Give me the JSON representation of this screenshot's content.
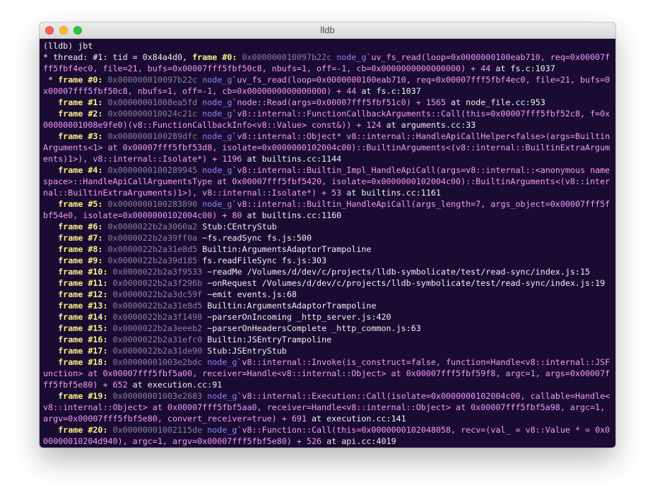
{
  "window": {
    "title": "lldb"
  },
  "terminal": {
    "lines": [
      [
        {
          "c": "txt",
          "t": "(lldb) jbt"
        }
      ],
      [
        {
          "c": "txt",
          "t": "* thread: #1: tid = 0x84a4d0, "
        },
        {
          "c": "fr",
          "t": "frame #0: "
        },
        {
          "c": "addr",
          "t": "0x000000010097b22c "
        },
        {
          "c": "mod",
          "t": "node_g"
        },
        {
          "c": "fn",
          "t": "`uv_fs_read(loop=0x0000000100eab710, req=0x00007fff5fbf4ec0, file=21, bufs=0x00007fff5fbf50c8, nbufs=1, off=-1, cb=0x0000000000000000) + 44 "
        },
        {
          "c": "txt",
          "t": "at fs.c:1037"
        }
      ],
      [
        {
          "c": "txt",
          "t": " * "
        },
        {
          "c": "fr",
          "t": "frame #0: "
        },
        {
          "c": "addr",
          "t": "0x000000010097b22c "
        },
        {
          "c": "mod",
          "t": "node_g"
        },
        {
          "c": "fn",
          "t": "`uv_fs_read(loop=0x0000000100eab710, req=0x00007fff5fbf4ec0, file=21, bufs=0x00007fff5fbf50c8, nbufs=1, off=-1, cb=0x0000000000000000) + 44 "
        },
        {
          "c": "txt",
          "t": "at fs.c:1037"
        }
      ],
      [
        {
          "c": "txt",
          "t": "   "
        },
        {
          "c": "fr",
          "t": "frame #1: "
        },
        {
          "c": "addr",
          "t": "0x00000001008ea5fd "
        },
        {
          "c": "mod",
          "t": "node_g"
        },
        {
          "c": "fn",
          "t": "`node::Read(args=0x00007fff5fbf51c0) + 1565 "
        },
        {
          "c": "txt",
          "t": "at node_file.cc:953"
        }
      ],
      [
        {
          "c": "txt",
          "t": "   "
        },
        {
          "c": "fr",
          "t": "frame #2: "
        },
        {
          "c": "addr",
          "t": "0x000000010024c21c "
        },
        {
          "c": "mod",
          "t": "node_g"
        },
        {
          "c": "fn",
          "t": "`v8::internal::FunctionCallbackArguments::Call(this=0x00007fff5fbf52c8, f=0x00000001008e9fe0)(v8::FunctionCallbackInfo<v8::Value> const&)) + 124 "
        },
        {
          "c": "txt",
          "t": "at arguments.cc:33"
        }
      ],
      [
        {
          "c": "txt",
          "t": "   "
        },
        {
          "c": "fr",
          "t": "frame #3: "
        },
        {
          "c": "addr",
          "t": "0x0000000100289dfc "
        },
        {
          "c": "mod",
          "t": "node_g"
        },
        {
          "c": "fn",
          "t": "`v8::internal::Object* v8::internal::HandleApiCallHelper<false>(args=BuiltinArguments<1> at 0x00007fff5fbf53d8, isolate=0x0000000102004c00)::BuiltinArguments<(v8::internal::BuiltinExtraArguments)1>), v8::internal::Isolate*) + 1196 "
        },
        {
          "c": "txt",
          "t": "at builtins.cc:1144"
        }
      ],
      [
        {
          "c": "txt",
          "t": "   "
        },
        {
          "c": "fr",
          "t": "frame #4: "
        },
        {
          "c": "addr",
          "t": "0x0000000100289945 "
        },
        {
          "c": "mod",
          "t": "node_g"
        },
        {
          "c": "fn",
          "t": "`v8::internal::Builtin_Impl_HandleApiCall(args=v8::internal::<anonymous namespace>::HandleApiCallArgumentsType at 0x00007fff5fbf5420, isolate=0x0000000102004c00)::BuiltinArguments<(v8::internal::BuiltinExtraArguments)1>), v8::internal::Isolate*) + 53 "
        },
        {
          "c": "txt",
          "t": "at builtins.cc:1161"
        }
      ],
      [
        {
          "c": "txt",
          "t": "   "
        },
        {
          "c": "fr",
          "t": "frame #5: "
        },
        {
          "c": "addr",
          "t": "0x0000000100283890 "
        },
        {
          "c": "mod",
          "t": "node_g"
        },
        {
          "c": "fn",
          "t": "`v8::internal::Builtin_HandleApiCall(args_length=7, args_object=0x00007fff5fbf54e0, isolate=0x0000000102004c00) + 80 "
        },
        {
          "c": "txt",
          "t": "at builtins.cc:1160"
        }
      ],
      [
        {
          "c": "txt",
          "t": "   "
        },
        {
          "c": "fr",
          "t": "frame #6: "
        },
        {
          "c": "addr",
          "t": "0x0000022b2a3060a2 "
        },
        {
          "c": "txt",
          "t": "Stub:CEntryStub"
        }
      ],
      [
        {
          "c": "txt",
          "t": "   "
        },
        {
          "c": "fr",
          "t": "frame #7: "
        },
        {
          "c": "addr",
          "t": "0x0000022b2a39ff0a "
        },
        {
          "c": "txt",
          "t": "~fs.readSync fs.js:500"
        }
      ],
      [
        {
          "c": "txt",
          "t": "   "
        },
        {
          "c": "fr",
          "t": "frame #8: "
        },
        {
          "c": "addr",
          "t": "0x0000022b2a31e8d5 "
        },
        {
          "c": "txt",
          "t": "Builtin:ArgumentsAdaptorTrampoline"
        }
      ],
      [
        {
          "c": "txt",
          "t": "   "
        },
        {
          "c": "fr",
          "t": "frame #9: "
        },
        {
          "c": "addr",
          "t": "0x0000022b2a39d185 "
        },
        {
          "c": "txt",
          "t": "fs.readFileSync fs.js:303"
        }
      ],
      [
        {
          "c": "txt",
          "t": "   "
        },
        {
          "c": "fr",
          "t": "frame #10: "
        },
        {
          "c": "addr",
          "t": "0x0000022b2a3f9533 "
        },
        {
          "c": "txt",
          "t": "~readMe /Volumes/d/dev/c/projects/lldb-symbolicate/test/read-sync/index.js:15"
        }
      ],
      [
        {
          "c": "txt",
          "t": "   "
        },
        {
          "c": "fr",
          "t": "frame #11: "
        },
        {
          "c": "addr",
          "t": "0x0000022b2a3f296b "
        },
        {
          "c": "txt",
          "t": "~onRequest /Volumes/d/dev/c/projects/lldb-symbolicate/test/read-sync/index.js:19"
        }
      ],
      [
        {
          "c": "txt",
          "t": "   "
        },
        {
          "c": "fr",
          "t": "frame #12: "
        },
        {
          "c": "addr",
          "t": "0x0000022b2a3dc59f "
        },
        {
          "c": "txt",
          "t": "~emit events.js:68"
        }
      ],
      [
        {
          "c": "txt",
          "t": "   "
        },
        {
          "c": "fr",
          "t": "frame #13: "
        },
        {
          "c": "addr",
          "t": "0x0000022b2a31e8d5 "
        },
        {
          "c": "txt",
          "t": "Builtin:ArgumentsAdaptorTrampoline"
        }
      ],
      [
        {
          "c": "txt",
          "t": "   "
        },
        {
          "c": "fr",
          "t": "frame #14: "
        },
        {
          "c": "addr",
          "t": "0x0000022b2a3f1498 "
        },
        {
          "c": "txt",
          "t": "~parserOnIncoming _http_server.js:420"
        }
      ],
      [
        {
          "c": "txt",
          "t": "   "
        },
        {
          "c": "fr",
          "t": "frame #15: "
        },
        {
          "c": "addr",
          "t": "0x0000022b2a3eeeb2 "
        },
        {
          "c": "txt",
          "t": "~parserOnHeadersComplete _http_common.js:63"
        }
      ],
      [
        {
          "c": "txt",
          "t": "   "
        },
        {
          "c": "fr",
          "t": "frame #16: "
        },
        {
          "c": "addr",
          "t": "0x0000022b2a31efc0 "
        },
        {
          "c": "txt",
          "t": "Builtin:JSEntryTrampoline"
        }
      ],
      [
        {
          "c": "txt",
          "t": "   "
        },
        {
          "c": "fr",
          "t": "frame #17: "
        },
        {
          "c": "addr",
          "t": "0x0000022b2a31de90 "
        },
        {
          "c": "txt",
          "t": "Stub:JSEntryStub"
        }
      ],
      [
        {
          "c": "txt",
          "t": "   "
        },
        {
          "c": "fr",
          "t": "frame #18: "
        },
        {
          "c": "addr",
          "t": "0x00000001003e2bdc "
        },
        {
          "c": "mod",
          "t": "node_g"
        },
        {
          "c": "fn",
          "t": "`v8::internal::Invoke(is_construct=false, function=Handle<v8::internal::JSFunction> at 0x00007fff5fbf5a00, receiver=Handle<v8::internal::Object> at 0x00007fff5fbf59f8, argc=1, args=0x00007fff5fbf5e80) + 652 "
        },
        {
          "c": "txt",
          "t": "at execution.cc:91"
        }
      ],
      [
        {
          "c": "txt",
          "t": "   "
        },
        {
          "c": "fr",
          "t": "frame #19: "
        },
        {
          "c": "addr",
          "t": "0x00000001003e2683 "
        },
        {
          "c": "mod",
          "t": "node_g"
        },
        {
          "c": "fn",
          "t": "`v8::internal::Execution::Call(isolate=0x0000000102004c00, callable=Handle<v8::internal::Object> at 0x00007fff5fbf5aa0, receiver=Handle<v8::internal::Object> at 0x00007fff5fbf5a98, argc=1, argv=0x00007fff5fbf5e80, convert_receiver=true) + 691 "
        },
        {
          "c": "txt",
          "t": "at execution.cc:141"
        }
      ],
      [
        {
          "c": "txt",
          "t": "   "
        },
        {
          "c": "fr",
          "t": "frame #20: "
        },
        {
          "c": "addr",
          "t": "0x00000001002115de "
        },
        {
          "c": "mod",
          "t": "node_g"
        },
        {
          "c": "fn",
          "t": "`v8::Function::Call(this=0x0000000102048058, recv=(val_ = v8::Value * = 0x000000010204d940), argc=1, argv=0x00007fff5fbf5e80) + 526 "
        },
        {
          "c": "txt",
          "t": "at api.cc:4019"
        }
      ]
    ]
  },
  "colors": {
    "background": "#1a0b33",
    "frame_label": "#fef080",
    "address": "#8a819c",
    "module": "#8a86ff",
    "function": "#f59bf5",
    "text": "#f0f0f0"
  }
}
